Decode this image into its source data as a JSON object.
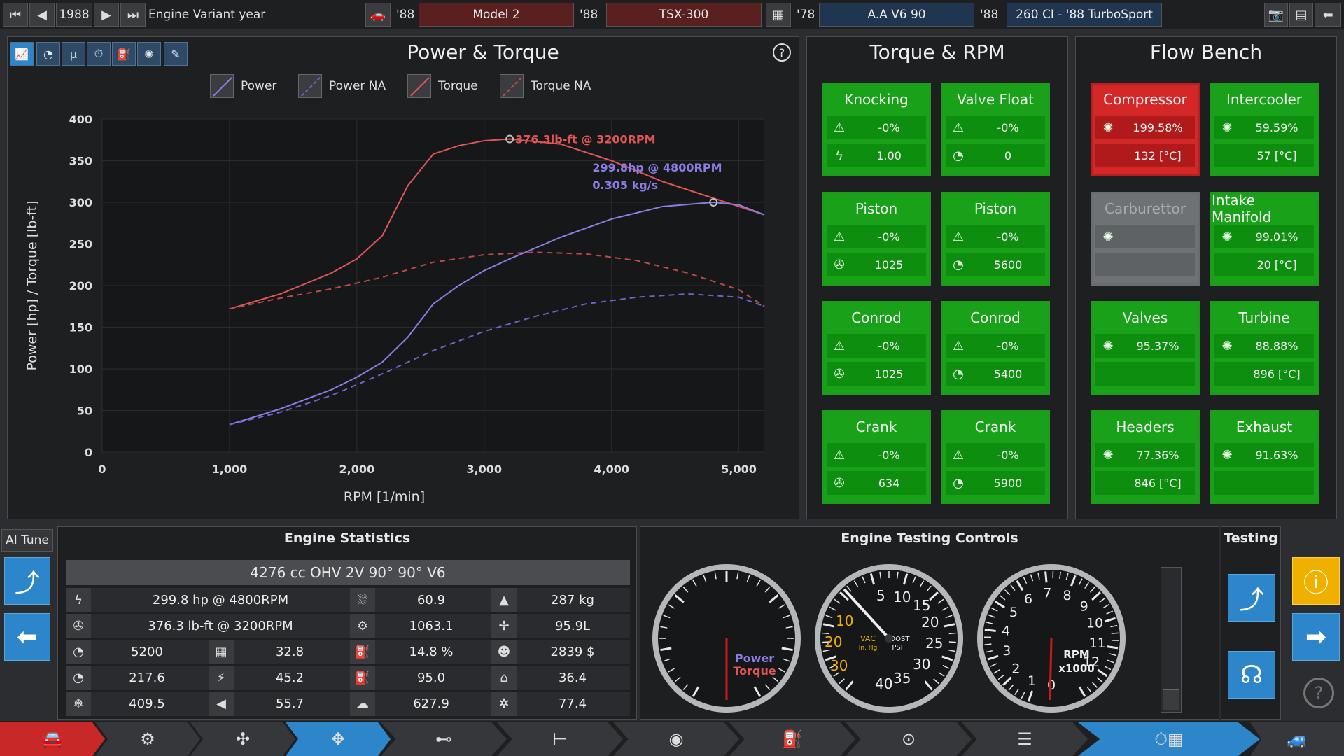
{
  "topbar": {
    "year": "1988",
    "year_label": "Engine Variant year",
    "fam1_year": "'88",
    "model": "Model 2",
    "trim_year": "'88",
    "trim": "TSX-300",
    "fam_year": "'78",
    "family": "A.A V6 90",
    "var_year": "'88",
    "variant": "260 CI - '88 TurboSport"
  },
  "power_torque": {
    "title": "Power & Torque",
    "legend": [
      "Power",
      "Power NA",
      "Torque",
      "Torque NA"
    ],
    "ann_torque": "376.3lb-ft @ 3200RPM",
    "ann_power1": "299.8hp @ 4800RPM",
    "ann_power2": "0.305 kg/s"
  },
  "chart_data": {
    "type": "line",
    "xlabel": "RPM [1/min]",
    "ylabel": "Power [hp] / Torque [lb-ft]",
    "xlim": [
      0,
      5200
    ],
    "ylim": [
      0,
      400
    ],
    "x_ticks": [
      "0",
      "1,000",
      "2,000",
      "3,000",
      "4,000",
      "5,000"
    ],
    "y_ticks": [
      "0",
      "50",
      "100",
      "150",
      "200",
      "250",
      "300",
      "350",
      "400"
    ],
    "series": [
      {
        "name": "Torque",
        "color": "#e05555",
        "dash": false,
        "x": [
          1000,
          1400,
          1800,
          2000,
          2200,
          2400,
          2600,
          2800,
          3000,
          3200,
          3600,
          4000,
          4400,
          4800,
          5200
        ],
        "y": [
          172,
          190,
          215,
          232,
          260,
          320,
          358,
          368,
          374,
          376,
          370,
          350,
          325,
          305,
          285
        ]
      },
      {
        "name": "Torque NA",
        "color": "#c04a4a",
        "dash": true,
        "x": [
          1000,
          1400,
          1800,
          2200,
          2600,
          3000,
          3400,
          3800,
          4200,
          4600,
          5000,
          5200
        ],
        "y": [
          172,
          185,
          196,
          210,
          228,
          237,
          240,
          238,
          230,
          215,
          195,
          175
        ]
      },
      {
        "name": "Power",
        "color": "#8a7ee6",
        "dash": false,
        "x": [
          1000,
          1400,
          1800,
          2000,
          2200,
          2400,
          2600,
          2800,
          3000,
          3200,
          3600,
          4000,
          4400,
          4800,
          5000,
          5200
        ],
        "y": [
          33,
          52,
          75,
          90,
          108,
          138,
          178,
          200,
          218,
          232,
          258,
          280,
          295,
          300,
          297,
          285
        ]
      },
      {
        "name": "Power NA",
        "color": "#6a66c8",
        "dash": true,
        "x": [
          1000,
          1400,
          1800,
          2200,
          2600,
          3000,
          3400,
          3800,
          4200,
          4600,
          5000,
          5200
        ],
        "y": [
          33,
          48,
          68,
          94,
          122,
          145,
          163,
          178,
          186,
          190,
          186,
          175
        ]
      }
    ]
  },
  "torque_rpm": {
    "title": "Torque & RPM",
    "cells": [
      {
        "title": "Knocking",
        "v1": "-0%",
        "v2": "1.00"
      },
      {
        "title": "Valve Float",
        "v1": "-0%",
        "v2": "0"
      },
      {
        "title": "Piston",
        "v1": "-0%",
        "v2": "1025"
      },
      {
        "title": "Piston",
        "v1": "-0%",
        "v2": "5600"
      },
      {
        "title": "Conrod",
        "v1": "-0%",
        "v2": "1025"
      },
      {
        "title": "Conrod",
        "v1": "-0%",
        "v2": "5400"
      },
      {
        "title": "Crank",
        "v1": "-0%",
        "v2": "634"
      },
      {
        "title": "Crank",
        "v1": "-0%",
        "v2": "5900"
      }
    ]
  },
  "flow_bench": {
    "title": "Flow Bench",
    "cells": [
      {
        "title": "Compressor",
        "v1": "199.58%",
        "v2": "132 [°C]"
      },
      {
        "title": "Intercooler",
        "v1": "59.59%",
        "v2": "57 [°C]"
      },
      {
        "title": "Carburettor",
        "v1": "",
        "v2": ""
      },
      {
        "title": "Intake Manifold",
        "v1": "99.01%",
        "v2": "20 [°C]"
      },
      {
        "title": "Valves",
        "v1": "95.37%",
        "v2": ""
      },
      {
        "title": "Turbine",
        "v1": "88.88%",
        "v2": "896 [°C]"
      },
      {
        "title": "Headers",
        "v1": "77.36%",
        "v2": "846 [°C]"
      },
      {
        "title": "Exhaust",
        "v1": "91.63%",
        "v2": ""
      }
    ]
  },
  "ai_tune": {
    "label": "AI Tune"
  },
  "engine_stats": {
    "title": "Engine Statistics",
    "summary": "4276 cc OHV 2V 90° 90° V6",
    "rows": [
      [
        "299.8 hp @ 4800RPM",
        "60.9",
        "287 kg"
      ],
      [
        "376.3 lb-ft @ 3200RPM",
        "1063.1",
        "95.9L"
      ],
      [
        "5200",
        "32.8",
        "14.8 %",
        "2839 $"
      ],
      [
        "217.6",
        "45.2",
        "95.0",
        "36.4"
      ],
      [
        "409.5",
        "55.7",
        "627.9",
        "77.4"
      ]
    ]
  },
  "testing_controls": {
    "title": "Engine Testing Controls",
    "gauge1": {
      "l1": "Power",
      "l2": "Torque"
    },
    "gauge2": {
      "vac": "VAC",
      "vac2": "In. Hg",
      "boost": "BOOST",
      "boost2": "PSI",
      "t_neg10": "10",
      "t_neg20": "20",
      "t_neg30": "30",
      "t5": "5",
      "t10": "10",
      "t15": "15",
      "t20": "20",
      "t25": "25",
      "t30": "30",
      "t35": "35",
      "t40": "40"
    },
    "gauge3": {
      "rpm": "RPM",
      "x": "x1000",
      "n": [
        "0",
        "1",
        "2",
        "3",
        "4",
        "5",
        "6",
        "7",
        "8",
        "9",
        "10",
        "11",
        "12"
      ]
    }
  },
  "testing": {
    "title": "Testing"
  }
}
